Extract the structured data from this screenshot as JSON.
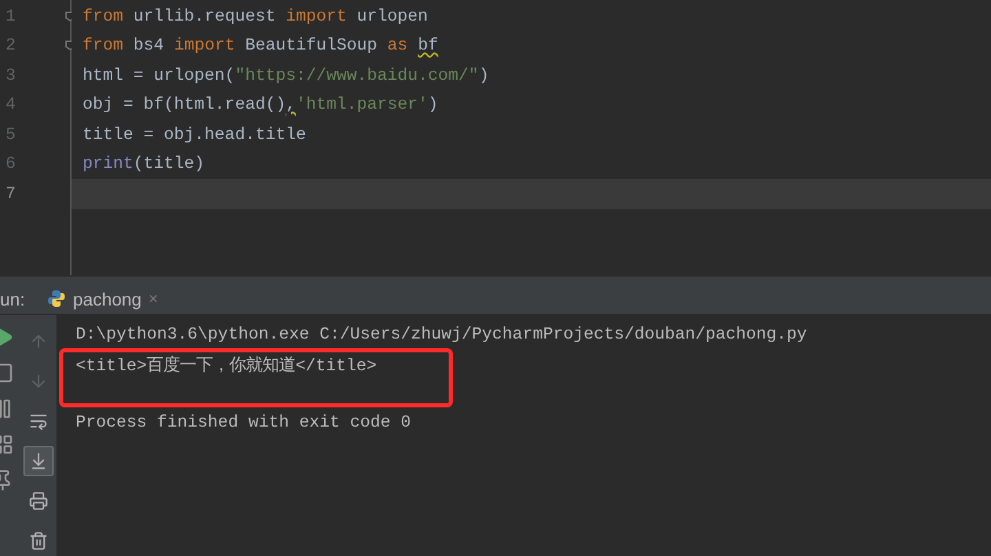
{
  "editor": {
    "lines": [
      {
        "number": "1",
        "current": false,
        "tokens": [
          {
            "kind": "keyword",
            "text": "from"
          },
          {
            "kind": "plain",
            "text": " urllib.request "
          },
          {
            "kind": "keyword",
            "text": "import"
          },
          {
            "kind": "plain",
            "text": " urlopen"
          }
        ]
      },
      {
        "number": "2",
        "current": false,
        "tokens": [
          {
            "kind": "keyword",
            "text": "from"
          },
          {
            "kind": "plain",
            "text": " bs4 "
          },
          {
            "kind": "keyword",
            "text": "import"
          },
          {
            "kind": "plain",
            "text": " BeautifulSoup "
          },
          {
            "kind": "keyword",
            "text": "as "
          },
          {
            "kind": "warning",
            "text": "bf"
          }
        ]
      },
      {
        "number": "3",
        "current": false,
        "tokens": [
          {
            "kind": "plain",
            "text": "html = urlopen("
          },
          {
            "kind": "string",
            "text": "\"https://www.baidu.com/\""
          },
          {
            "kind": "plain",
            "text": ")"
          }
        ]
      },
      {
        "number": "4",
        "current": false,
        "tokens": [
          {
            "kind": "plain",
            "text": "obj = bf(html.read()"
          },
          {
            "kind": "warning",
            "text": ","
          },
          {
            "kind": "string",
            "text": "'html.parser'"
          },
          {
            "kind": "plain",
            "text": ")"
          }
        ]
      },
      {
        "number": "5",
        "current": false,
        "tokens": [
          {
            "kind": "plain",
            "text": "title = obj.head.title"
          }
        ]
      },
      {
        "number": "6",
        "current": false,
        "tokens": [
          {
            "kind": "builtin",
            "text": "print"
          },
          {
            "kind": "plain",
            "text": "(title)"
          }
        ]
      },
      {
        "number": "7",
        "current": true
      }
    ]
  },
  "run_panel": {
    "label": "un:",
    "tab": {
      "label": "pachong",
      "close": "×"
    },
    "side_tools": [
      {
        "kind": "play"
      },
      {
        "kind": "stop"
      },
      {
        "kind": "pause"
      },
      {
        "kind": "layout"
      },
      {
        "kind": "pin"
      }
    ],
    "tools": [
      {
        "kind": "up",
        "selected": false,
        "disabled": true
      },
      {
        "kind": "down",
        "selected": false,
        "disabled": true
      },
      {
        "kind": "wrap",
        "selected": false,
        "disabled": false
      },
      {
        "kind": "scroll",
        "selected": true,
        "disabled": false
      },
      {
        "kind": "print",
        "selected": false,
        "disabled": false
      },
      {
        "kind": "trash",
        "selected": false,
        "disabled": false
      }
    ],
    "console": [
      {
        "text": "D:\\python3.6\\python.exe C:/Users/zhuwj/PycharmProjects/douban/pachong.py",
        "highlighted": false
      },
      {
        "text": "<title>百度一下，你就知道</title>",
        "highlighted": true
      },
      {
        "text": "Process finished with exit code 0",
        "highlighted": false
      }
    ]
  }
}
